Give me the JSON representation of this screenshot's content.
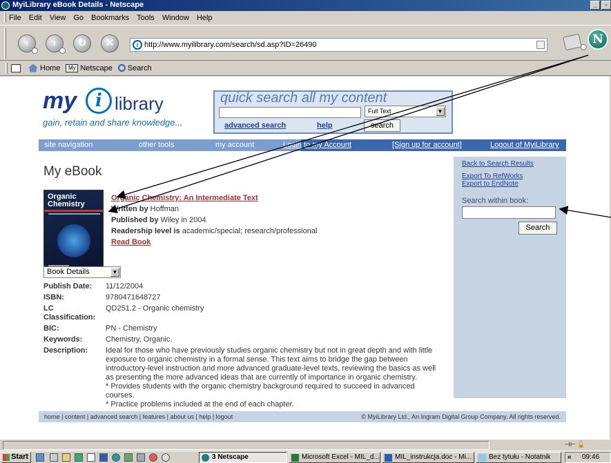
{
  "window": {
    "title": "MyiLibrary eBook Details - Netscape"
  },
  "menu": [
    "File",
    "Edit",
    "View",
    "Go",
    "Bookmarks",
    "Tools",
    "Window",
    "Help"
  ],
  "url": "http://www.myilibrary.com/search/sd.asp?ID=26490",
  "personal_toolbar": {
    "home": "Home",
    "netscape": "Netscape",
    "search": "Search",
    "my_icon": "My"
  },
  "logo": {
    "my": "my",
    "i": "i",
    "library": "library",
    "tagline": "gain, retain and share knowledge..."
  },
  "quick_search": {
    "title": "quick search all my content",
    "select_value": "Full Text",
    "advanced": "advanced search",
    "help": "help",
    "button": "search"
  },
  "site_nav": {
    "site_navigation": "site navigation",
    "other_tools": "other tools",
    "my_account": "my account",
    "login": "Login to my Account",
    "signup": "[Sign up for account]",
    "logout": "Logout of MyiLibrary"
  },
  "page_title": "My eBook",
  "book": {
    "title": "Organic Chemistry: An Intermediate Text",
    "written_by_label": "Written by",
    "author": "Hoffman",
    "published_by_label": "Published by",
    "publisher": "Wiley in 2004",
    "readership_label": "Readership level is",
    "readership": "academic/special; research/professional",
    "read_book": "Read Book",
    "cover_line1": "Organic",
    "cover_line2": "Chemistry"
  },
  "sidebar": {
    "back": "Back to Search Results",
    "refworks": "Export To RefWorks",
    "endnote": "Export to EndNote",
    "search_label": "Search within book:",
    "search_button": "Search"
  },
  "details_select": "Book Details",
  "details": {
    "publish_date_label": "Publish Date:",
    "publish_date": "11/12/2004",
    "isbn_label": "ISBN:",
    "isbn": "9780471648727",
    "lc_label": "LC Classification:",
    "lc": "QD251.2 - Organic chemistry",
    "bic_label": "BIC:",
    "bic": "PN - Chemistry",
    "keywords_label": "Keywords:",
    "keywords": "Chemistry, Organic.",
    "description_label": "Description:",
    "description_1": "Ideal for those who have previously studies organic chemistry but not in great depth and with little exposure to organic chemistry in a formal sense. This text aims to bridge the gap between introductory-level instruction and more advanced graduate-level texts, reviewing the basics as well as presenting the more advanced ideas that are currently of importance in organic chemistry.",
    "description_2": "* Provides students with the organic chemistry background required to succeed in advanced courses.",
    "description_3": "* Practice problems included at the end of each chapter."
  },
  "footer": {
    "links": "home  |  content  |  advanced search  |  features  |  about us  |  help  |  logout",
    "copyright": "© MyiLibrary Ltd., An Ingram Digital Group Company. All rights reserved."
  },
  "taskbar": {
    "start": "Start",
    "netscape": "3 Netscape",
    "excel": "Microsoft Excel - MIL_d...",
    "word": "MIL_instrukcja.doc - Mi...",
    "notepad": "Bez tytułu - Notatnik",
    "clock": "09:46",
    "tray_chevron": "«"
  },
  "colors": {
    "nav_light": "#7c9dd0",
    "nav_dark": "#3b66b0",
    "sidebar_bg": "#c6d3e2",
    "link_red": "#993333",
    "link_blue": "#1f3f93"
  }
}
